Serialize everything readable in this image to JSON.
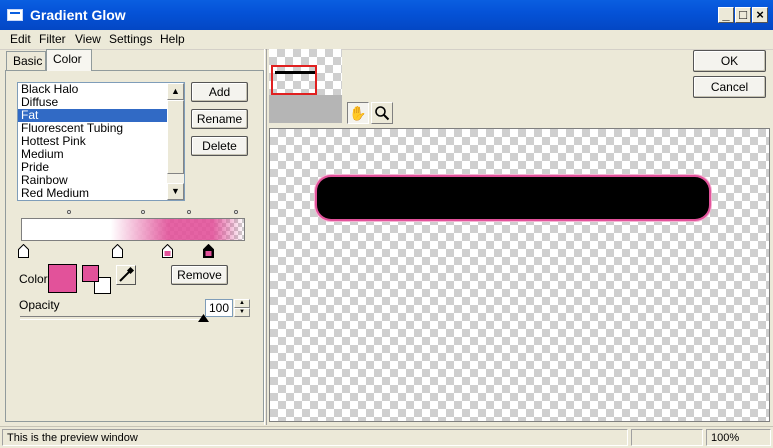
{
  "window": {
    "title": "Gradient Glow"
  },
  "menu": [
    "Edit",
    "Filter",
    "View",
    "Settings",
    "Help"
  ],
  "tabs": [
    "Basic",
    "Color"
  ],
  "active_tab": "Color",
  "presets": {
    "items": [
      "Black Halo",
      "Diffuse",
      "Fat",
      "Fluorescent Tubing",
      "Hottest Pink",
      "Medium",
      "Pride",
      "Rainbow",
      "Red Medium"
    ],
    "selected": "Fat"
  },
  "buttons": {
    "add": "Add",
    "rename": "Rename",
    "delete": "Delete",
    "remove": "Remove",
    "ok": "OK",
    "cancel": "Cancel"
  },
  "color": {
    "label": "Color",
    "current": "#e2529a",
    "foreground": "#e2529a",
    "background": "#ffffff"
  },
  "opacity": {
    "label": "Opacity",
    "value": "100",
    "fraction": 1.0
  },
  "status": {
    "message": "This is the preview window",
    "zoom": "100%"
  },
  "colors": {
    "glow": "#e2529a",
    "selection": "#316ac5",
    "titlebar": "#0553d8"
  },
  "icons": {
    "hand": "hand-pan-icon",
    "zoom": "magnifier-icon",
    "picker": "eyedropper-icon"
  }
}
